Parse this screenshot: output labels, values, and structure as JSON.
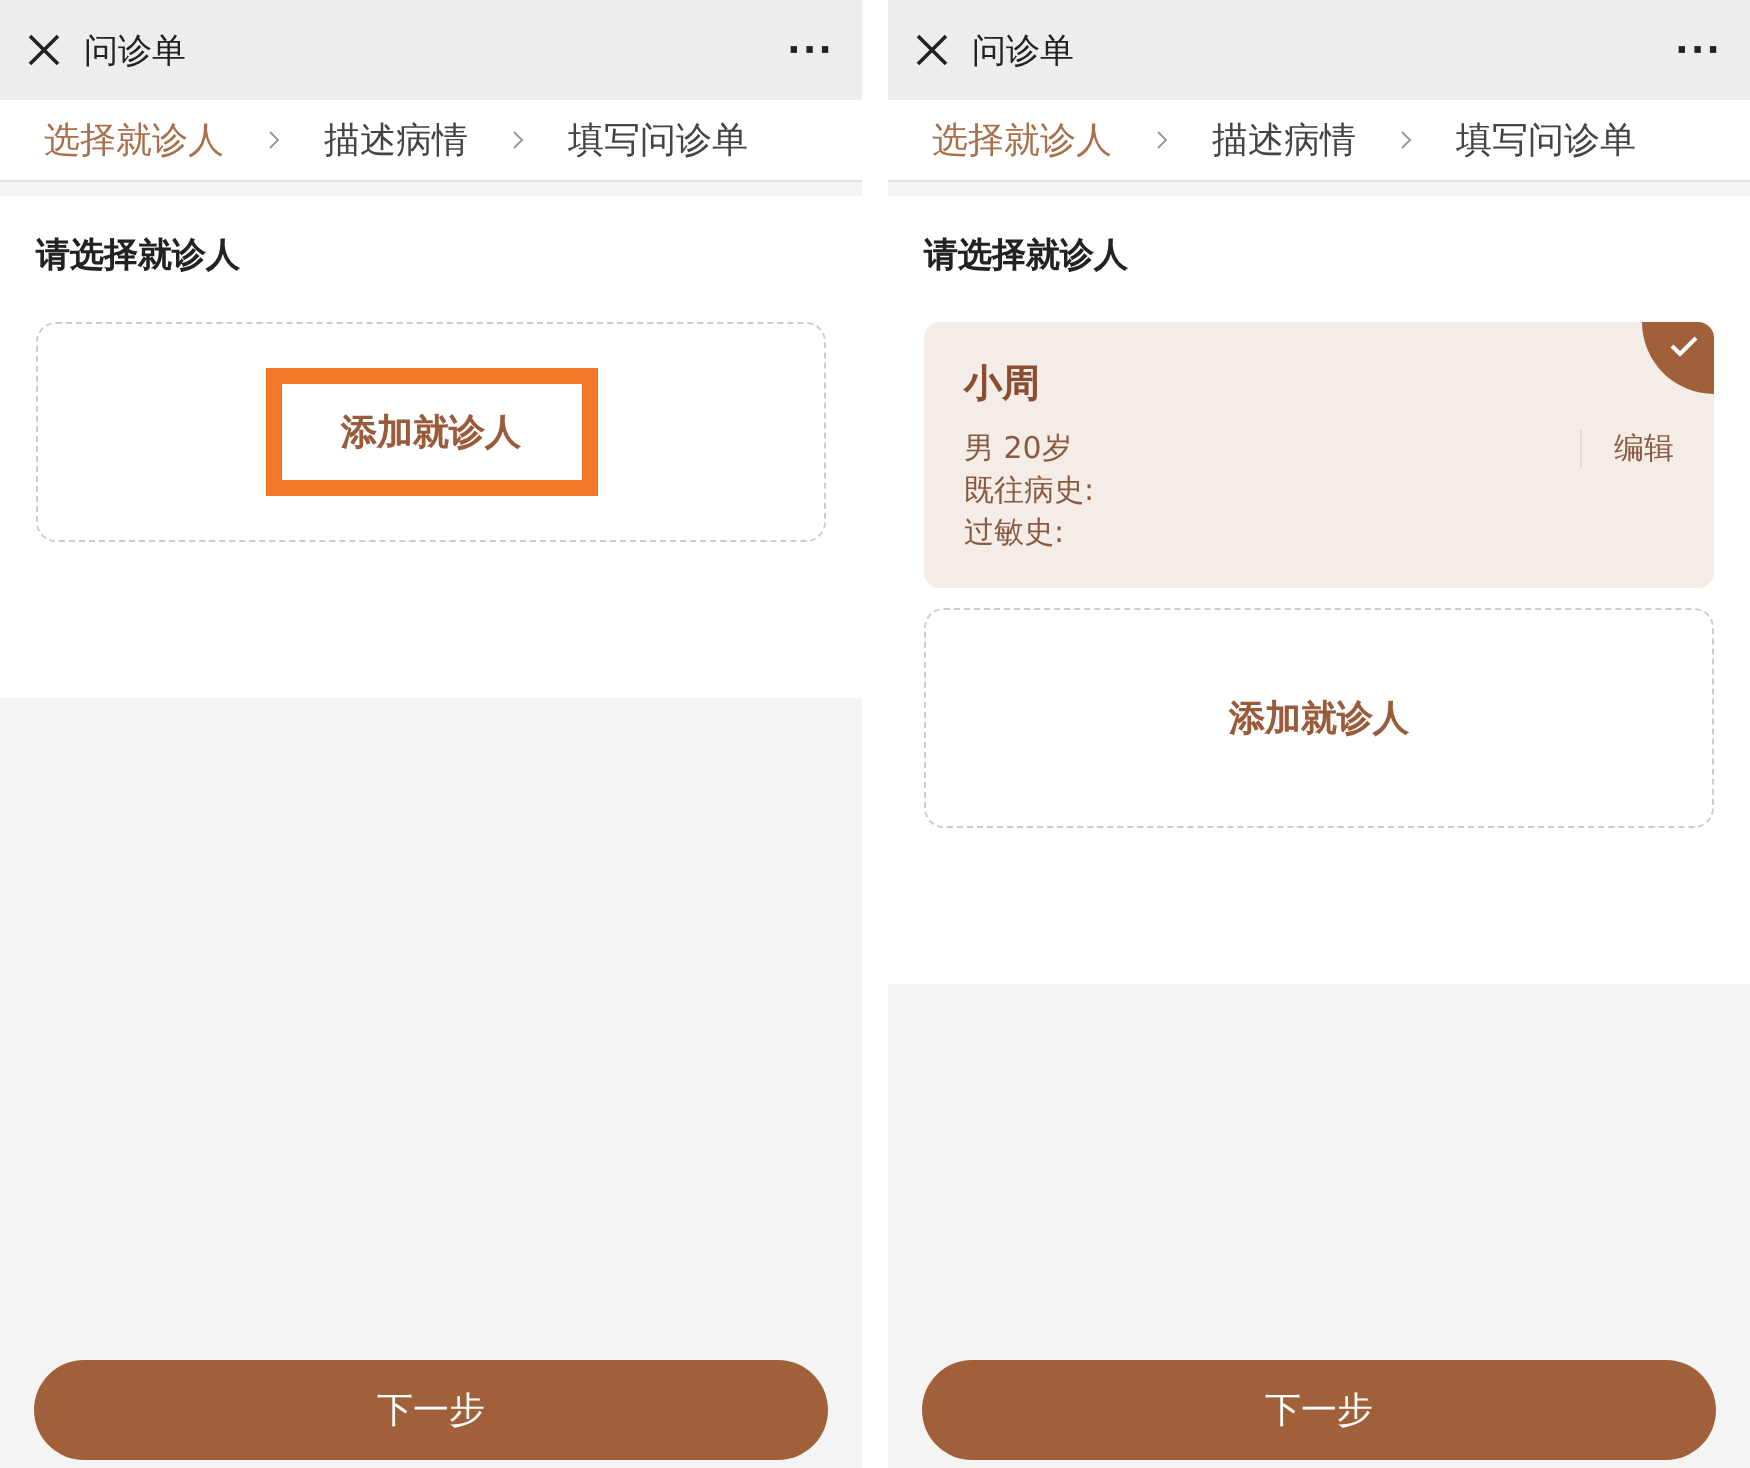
{
  "screens": [
    {
      "title": "问诊单",
      "menu": "···",
      "steps": [
        {
          "label": "选择就诊人",
          "selected": true
        },
        {
          "label": "描述病情",
          "selected": false
        },
        {
          "label": "填写问诊单",
          "selected": false
        }
      ],
      "section_title": "请选择就诊人",
      "add_button": {
        "label": "添加就诊人",
        "highlighted": true
      },
      "next_button": "下一步"
    },
    {
      "title": "问诊单",
      "menu": "···",
      "steps": [
        {
          "label": "选择就诊人",
          "selected": true
        },
        {
          "label": "描述病情",
          "selected": false
        },
        {
          "label": "填写问诊单",
          "selected": false
        }
      ],
      "section_title": "请选择就诊人",
      "patients": [
        {
          "name": "小周",
          "info": "男 20岁",
          "history": "既往病史:",
          "allergy": "过敏史:",
          "edit": "编辑",
          "selected": true
        }
      ],
      "add_button": {
        "label": "添加就诊人",
        "highlighted": false
      },
      "next_button": "下一步"
    }
  ]
}
